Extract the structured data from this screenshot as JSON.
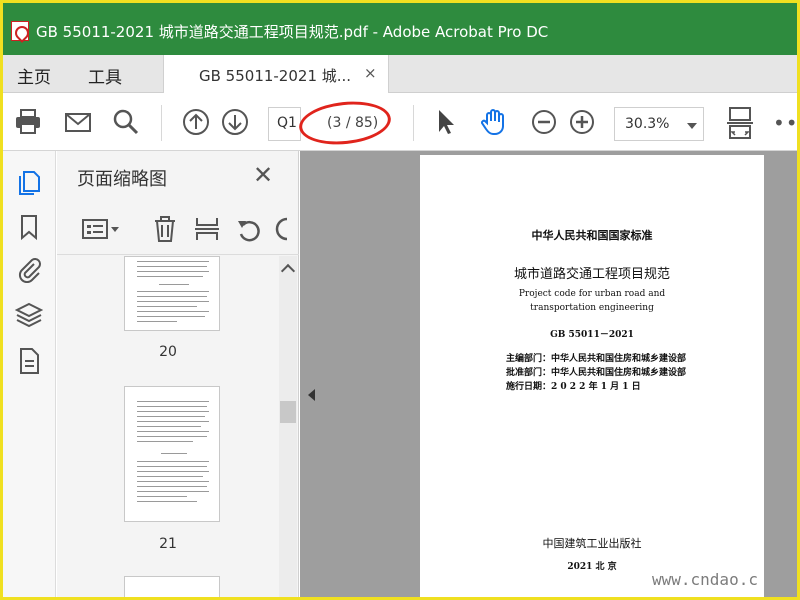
{
  "window": {
    "title": "GB 55011-2021 城市道路交通工程项目规范.pdf - Adobe Acrobat Pro DC",
    "title_color": "#2e8b3e"
  },
  "menu": {
    "home": "主页",
    "tools": "工具"
  },
  "tab": {
    "label": "GB 55011-2021 城...",
    "close": "×"
  },
  "toolbar": {
    "page_input": "Q1",
    "page_count": "(3 / 85)",
    "zoom": "30.3%",
    "more": "•••",
    "icons": [
      "printer-icon",
      "mail-icon",
      "search-icon",
      "page-up-icon",
      "page-down-icon",
      "select-arrow-icon",
      "hand-icon",
      "zoom-out-icon",
      "zoom-in-icon",
      "fit-page-icon"
    ]
  },
  "panel": {
    "title": "页面缩略图",
    "close": "✕",
    "thumbnails": [
      {
        "label": "20"
      },
      {
        "label": "21"
      }
    ]
  },
  "document": {
    "standard": "中华人民共和国国家标准",
    "title_cn": "城市道路交通工程项目规范",
    "title_en_1": "Project code for urban road and",
    "title_en_2": "transportation engineering",
    "code": "GB 55011－2021",
    "editor": "主编部门：中华人民共和国住房和城乡建设部",
    "approver": "批准部门：中华人民共和国住房和城乡建设部",
    "effective": "施行日期：2 0 2 2 年 1 月 1 日",
    "publisher": "中国建筑工业出版社",
    "city": "2021 北 京"
  },
  "watermark": {
    "site": "www.cndao.c"
  },
  "colors": {
    "accent_green": "#2e8b3e",
    "annotation_red": "#e0241c",
    "hand_blue": "#1473e6"
  }
}
